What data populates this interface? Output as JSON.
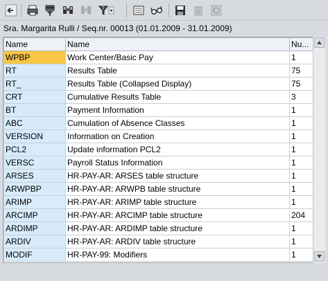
{
  "toolbar": {
    "icons": [
      "back-icon",
      "print-icon",
      "filter-icon",
      "find-icon",
      "find-next-icon",
      "set-filter-icon",
      "details-icon",
      "glasses-icon",
      "save-icon",
      "delete-icon",
      "refresh-icon"
    ]
  },
  "subtitle": "Sra. Margarita Rulli / Seq.nr. 00013 (01.01.2009 - 31.01.2009)",
  "table": {
    "headers": [
      "Name",
      "Name",
      "Nu..."
    ],
    "rows": [
      {
        "key": "WPBP",
        "desc": "Work Center/Basic Pay",
        "num": "1"
      },
      {
        "key": "RT",
        "desc": "Results Table",
        "num": "75"
      },
      {
        "key": "RT_",
        "desc": "Results Table (Collapsed Display)",
        "num": "75"
      },
      {
        "key": "CRT",
        "desc": "Cumulative Results Table",
        "num": "3"
      },
      {
        "key": "BT",
        "desc": "Payment Information",
        "num": "1"
      },
      {
        "key": "ABC",
        "desc": "Cumulation of Absence Classes",
        "num": "1"
      },
      {
        "key": "VERSION",
        "desc": "Information on Creation",
        "num": "1"
      },
      {
        "key": "PCL2",
        "desc": "Update information PCL2",
        "num": "1"
      },
      {
        "key": "VERSC",
        "desc": "Payroll Status Information",
        "num": "1"
      },
      {
        "key": "ARSES",
        "desc": "HR-PAY-AR: ARSES table structure",
        "num": "1"
      },
      {
        "key": "ARWPBP",
        "desc": "HR-PAY-AR: ARWPB table structure",
        "num": "1"
      },
      {
        "key": "ARIMP",
        "desc": "HR-PAY-AR: ARIMP table structure",
        "num": "1"
      },
      {
        "key": "ARCIMP",
        "desc": "HR-PAY-AR: ARCIMP table structure",
        "num": "204"
      },
      {
        "key": "ARDIMP",
        "desc": "HR-PAY-AR: ARDIMP table structure",
        "num": "1"
      },
      {
        "key": "ARDIV",
        "desc": "HR-PAY-AR: ARDIV table structure",
        "num": "1"
      },
      {
        "key": "MODIF",
        "desc": "HR-PAY-99: Modifiers",
        "num": "1"
      }
    ]
  }
}
